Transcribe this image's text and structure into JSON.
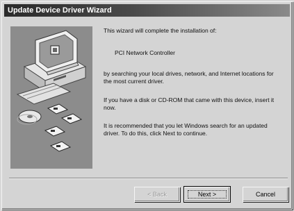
{
  "window": {
    "title": "Update Device Driver Wizard"
  },
  "content": {
    "intro": "This wizard will complete the installation of:",
    "device_name": "PCI Network Controller",
    "search_text": "by searching your local drives, network, and Internet locations for the most current driver.",
    "disk_text": "If you have a disk or CD-ROM that came with this device, insert it now.",
    "recommend_text": "It is recommended that you let Windows search for an updated driver. To do this, click Next to continue."
  },
  "buttons": {
    "back": "< Back",
    "next": "Next >",
    "cancel": "Cancel"
  },
  "colors": {
    "titlebar_start": "#2a2a2a",
    "window_face": "#d4d4d4",
    "art_panel": "#8c8c8c"
  },
  "icons": [
    "computer-icon",
    "monitor-icon",
    "cd-disc-icon",
    "floppy-disk-icon",
    "network-icon"
  ]
}
